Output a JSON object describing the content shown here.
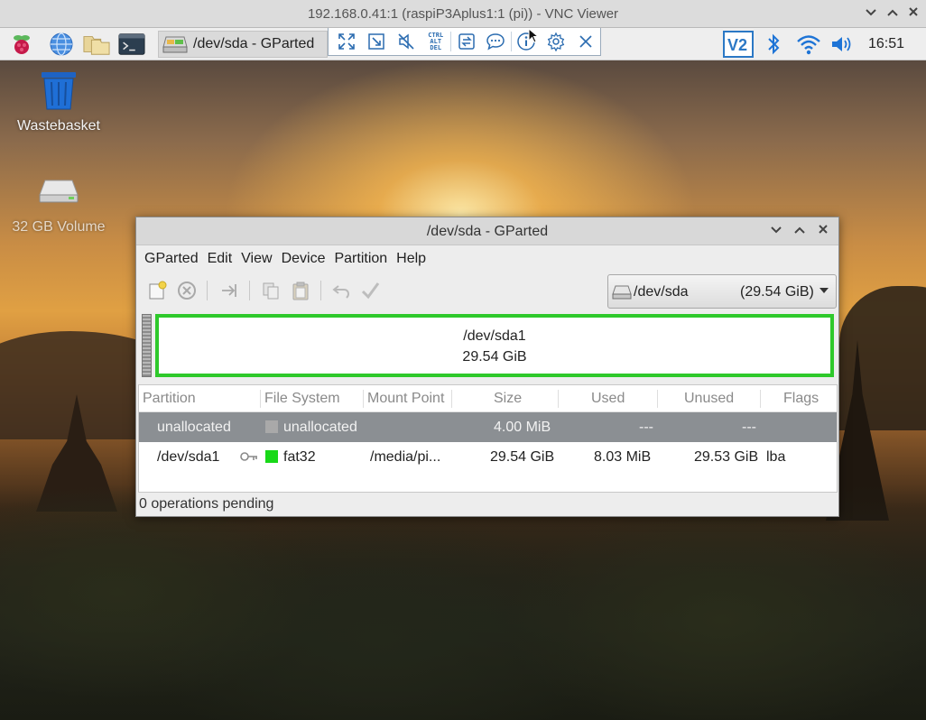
{
  "vnc": {
    "title": "192.168.0.41:1 (raspiP3Aplus1:1 (pi)) - VNC Viewer",
    "window_buttons": [
      "minimize",
      "maximize",
      "close"
    ],
    "toolbar_icons": [
      "fullscreen-icon",
      "scale-icon",
      "mute-icon",
      "ctrl-alt-del-icon",
      "transfer-files-icon",
      "chat-icon",
      "info-icon",
      "settings-icon",
      "close-toolbar-icon"
    ],
    "ctrl_alt_del_label": [
      "CTRL",
      "ALT",
      "DEL"
    ]
  },
  "panel": {
    "launchers": [
      "raspberry-menu-icon",
      "web-browser-icon",
      "file-manager-icon",
      "terminal-icon"
    ],
    "task_label": "/dev/sda - GParted",
    "tray": [
      "vnc-server-icon",
      "bluetooth-icon",
      "wifi-icon",
      "volume-icon"
    ],
    "clock": "16:51"
  },
  "desktop": {
    "icons": [
      {
        "label": "Wastebasket",
        "icon": "wastebasket-icon"
      },
      {
        "label": "32 GB Volume",
        "icon": "drive-icon"
      }
    ]
  },
  "gparted": {
    "title": "/dev/sda - GParted",
    "menu": [
      "GParted",
      "Edit",
      "View",
      "Device",
      "Partition",
      "Help"
    ],
    "toolbar_icons": [
      "new-partition-icon",
      "delete-partition-icon",
      "resize-move-icon",
      "copy-icon",
      "paste-icon",
      "undo-icon",
      "apply-icon"
    ],
    "device": {
      "name": "/dev/sda",
      "size": "(29.54 GiB)"
    },
    "map": {
      "name": "/dev/sda1",
      "size": "29.54 GiB"
    },
    "columns": [
      "Partition",
      "File System",
      "Mount Point",
      "Size",
      "Used",
      "Unused",
      "Flags"
    ],
    "rows": [
      {
        "partition": "unallocated",
        "filesystem": "unallocated",
        "fs_color": "#a9a9a9",
        "mount": "",
        "size": "4.00 MiB",
        "used": "---",
        "unused": "---",
        "flags": "",
        "key": false,
        "selected": true
      },
      {
        "partition": "/dev/sda1",
        "filesystem": "fat32",
        "fs_color": "#18d918",
        "mount": "/media/pi...",
        "size": "29.54 GiB",
        "used": "8.03 MiB",
        "unused": "29.53 GiB",
        "flags": "lba",
        "key": true,
        "selected": false
      }
    ],
    "status": "0 operations pending"
  },
  "colors": {
    "accent": "#2b6cb0",
    "partition_border": "#2ec92b",
    "selected_row": "#8b8f93"
  }
}
